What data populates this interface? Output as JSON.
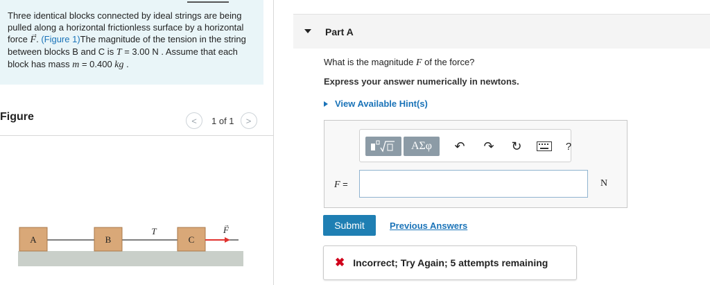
{
  "problem": {
    "text_1": "Three identical blocks connected by ideal strings are being pulled along a horizontal frictionless surface by a horizontal force ",
    "force_symbol": "F",
    "text_2": ". ",
    "figure_link": "(Figure 1)",
    "text_3": "The magnitude of the tension in the string between blocks B and C is ",
    "tension_symbol": "T",
    "text_4": " = 3.00 N . Assume that each block has mass ",
    "mass_symbol": "m",
    "text_5": " = 0.400 ",
    "mass_unit": "kg",
    "text_6": " ."
  },
  "figure": {
    "title": "Figure",
    "pager_label": "1 of 1",
    "prev_icon": "chevron-left-icon",
    "next_icon": "chevron-right-icon",
    "block_a": "A",
    "block_b": "B",
    "block_c": "C",
    "tension_label": "T",
    "force_label": "F",
    "block_color": "#d9a878",
    "surface_color": "#c9cfc9",
    "arrow_color": "#e0322f"
  },
  "part": {
    "title": "Part A",
    "question_prefix": "What is the magnitude ",
    "question_symbol": "F",
    "question_suffix": " of the force?",
    "instruction": "Express your answer numerically in newtons.",
    "hint_label": "View Available Hint(s)"
  },
  "toolbar": {
    "greek_label": "ΑΣφ",
    "icons": [
      "templates-icon",
      "greek-letters-icon",
      "undo-icon",
      "redo-icon",
      "reset-icon",
      "keyboard-icon",
      "help-icon"
    ],
    "help_label": "?"
  },
  "answer": {
    "label_symbol": "F",
    "label_suffix": " =",
    "value": "",
    "unit": "N"
  },
  "actions": {
    "submit_label": "Submit",
    "previous_answers_label": "Previous Answers"
  },
  "feedback": {
    "text": "Incorrect; Try Again; 5 attempts remaining",
    "icon": "x-icon",
    "icon_color": "#d0021b"
  }
}
